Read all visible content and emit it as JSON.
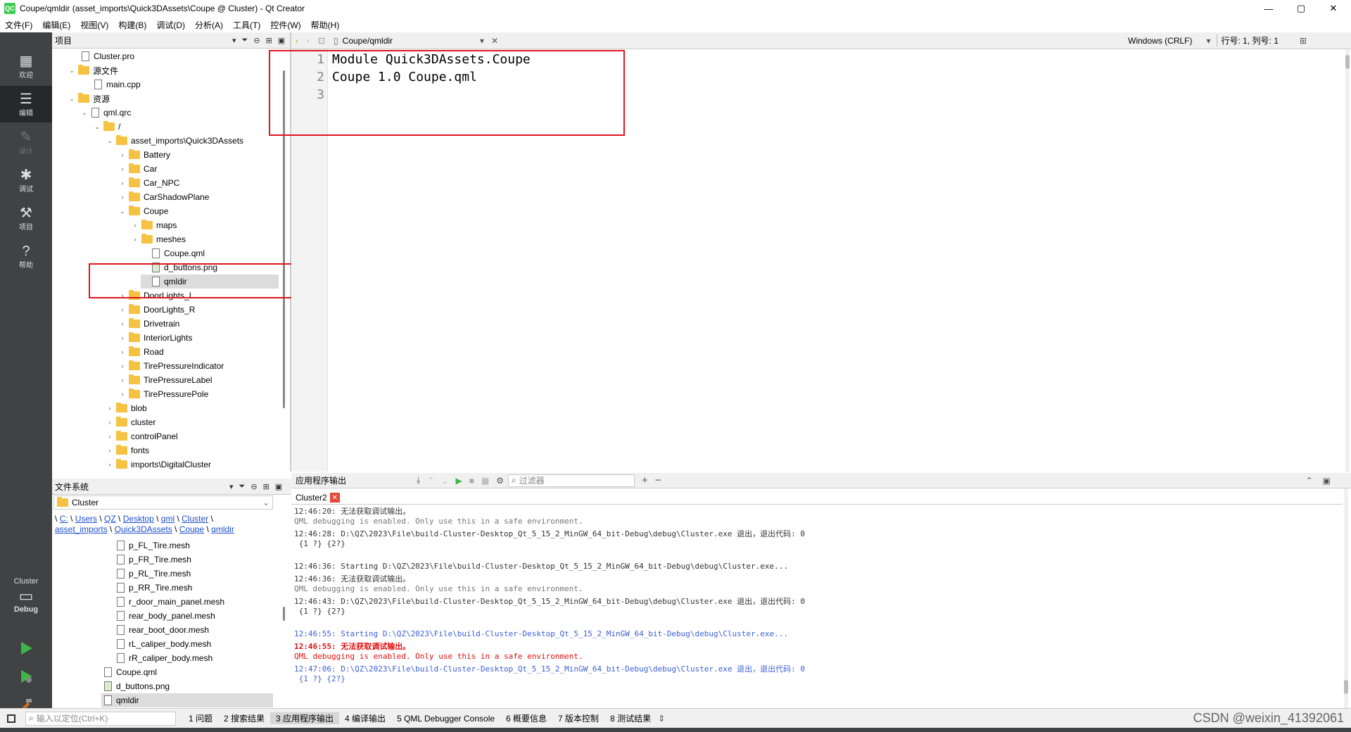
{
  "window": {
    "title": "Coupe/qmldir (asset_imports\\Quick3DAssets\\Coupe @ Cluster) - Qt Creator",
    "app_icon": "QC",
    "minimize": "—",
    "maximize": "▢",
    "close": "✕"
  },
  "menu": [
    "文件(F)",
    "编辑(E)",
    "视图(V)",
    "构建(B)",
    "调试(D)",
    "分析(A)",
    "工具(T)",
    "控件(W)",
    "帮助(H)"
  ],
  "modes": {
    "welcome": "欢迎",
    "edit": "编辑",
    "design": "设计",
    "debug": "调试",
    "projects": "项目",
    "help": "帮助"
  },
  "kit": {
    "name": "Cluster",
    "build": "Debug"
  },
  "projects_pane": {
    "title": "项目",
    "items": [
      {
        "label": "Cluster.pro",
        "kind": "file",
        "depth": 1,
        "arrow": ""
      },
      {
        "label": "源文件",
        "kind": "folder",
        "depth": 0,
        "arrow": "⌄"
      },
      {
        "label": "main.cpp",
        "kind": "file",
        "depth": 2,
        "arrow": ""
      },
      {
        "label": "资源",
        "kind": "folder",
        "depth": 0,
        "arrow": "⌄"
      },
      {
        "label": "qml.qrc",
        "kind": "file",
        "depth": 1,
        "arrow": "⌄"
      },
      {
        "label": "/",
        "kind": "folder",
        "depth": 2,
        "arrow": "⌄"
      },
      {
        "label": "asset_imports\\Quick3DAssets",
        "kind": "folder",
        "depth": 3,
        "arrow": "⌄"
      },
      {
        "label": "Battery",
        "kind": "folder",
        "depth": 4,
        "arrow": "›"
      },
      {
        "label": "Car",
        "kind": "folder",
        "depth": 4,
        "arrow": "›"
      },
      {
        "label": "Car_NPC",
        "kind": "folder",
        "depth": 4,
        "arrow": "›"
      },
      {
        "label": "CarShadowPlane",
        "kind": "folder",
        "depth": 4,
        "arrow": "›"
      },
      {
        "label": "Coupe",
        "kind": "folder",
        "depth": 4,
        "arrow": "⌄"
      },
      {
        "label": "maps",
        "kind": "folder",
        "depth": 5,
        "arrow": "›"
      },
      {
        "label": "meshes",
        "kind": "folder",
        "depth": 5,
        "arrow": "›"
      },
      {
        "label": "Coupe.qml",
        "kind": "file",
        "depth": 6,
        "arrow": ""
      },
      {
        "label": "d_buttons.png",
        "kind": "file",
        "depth": 6,
        "arrow": ""
      },
      {
        "label": "qmldir",
        "kind": "file",
        "depth": 6,
        "arrow": "",
        "selected": true
      },
      {
        "label": "DoorLights_L",
        "kind": "folder",
        "depth": 4,
        "arrow": "›"
      },
      {
        "label": "DoorLights_R",
        "kind": "folder",
        "depth": 4,
        "arrow": "›"
      },
      {
        "label": "Drivetrain",
        "kind": "folder",
        "depth": 4,
        "arrow": "›"
      },
      {
        "label": "InteriorLights",
        "kind": "folder",
        "depth": 4,
        "arrow": "›"
      },
      {
        "label": "Road",
        "kind": "folder",
        "depth": 4,
        "arrow": "›"
      },
      {
        "label": "TirePressureIndicator",
        "kind": "folder",
        "depth": 4,
        "arrow": "›"
      },
      {
        "label": "TirePressureLabel",
        "kind": "folder",
        "depth": 4,
        "arrow": "›"
      },
      {
        "label": "TirePressurePole",
        "kind": "folder",
        "depth": 4,
        "arrow": "›"
      },
      {
        "label": "blob",
        "kind": "folder",
        "depth": 3,
        "arrow": "›"
      },
      {
        "label": "cluster",
        "kind": "folder",
        "depth": 3,
        "arrow": "›"
      },
      {
        "label": "controlPanel",
        "kind": "folder",
        "depth": 3,
        "arrow": "›"
      },
      {
        "label": "fonts",
        "kind": "folder",
        "depth": 3,
        "arrow": "›"
      },
      {
        "label": "imports\\DigitalCluster",
        "kind": "folder",
        "depth": 3,
        "arrow": "›"
      }
    ]
  },
  "filesystem_pane": {
    "title": "文件系统",
    "root": "Cluster",
    "breadcrumb_line1": [
      "C:",
      "Users",
      "QZ",
      "Desktop",
      "qml",
      "Cluster"
    ],
    "breadcrumb_line2": [
      "asset_imports",
      "Quick3DAssets",
      "Coupe",
      "qmldir"
    ],
    "items": [
      {
        "label": "p_FL_Tire.mesh",
        "depth": 1
      },
      {
        "label": "p_FR_Tire.mesh",
        "depth": 1
      },
      {
        "label": "p_RL_Tire.mesh",
        "depth": 1
      },
      {
        "label": "p_RR_Tire.mesh",
        "depth": 1
      },
      {
        "label": "r_door_main_panel.mesh",
        "depth": 1
      },
      {
        "label": "rear_body_panel.mesh",
        "depth": 1
      },
      {
        "label": "rear_boot_door.mesh",
        "depth": 1
      },
      {
        "label": "rL_caliper_body.mesh",
        "depth": 1
      },
      {
        "label": "rR_caliper_body.mesh",
        "depth": 1
      },
      {
        "label": "Coupe.qml",
        "depth": 0
      },
      {
        "label": "d_buttons.png",
        "depth": 0
      },
      {
        "label": "qmldir",
        "depth": 0,
        "selected": true
      }
    ]
  },
  "editor": {
    "file_label": "Coupe/qmldir",
    "line_ending": "Windows (CRLF)",
    "position": "行号: 1, 列号: 1",
    "lines": [
      "Module Quick3DAssets.Coupe",
      "Coupe 1.0 Coupe.qml",
      ""
    ]
  },
  "output_pane": {
    "title": "应用程序输出",
    "filter_placeholder": "过滤器",
    "tab": "Cluster2",
    "lines": [
      {
        "text": "12:46:20: 无法获取调试输出。",
        "color": "#333333"
      },
      {
        "text": "QML debugging is enabled. Only use this in a safe environment.",
        "color": "#777777"
      },
      {
        "text": "12:46:28: D:\\QZ\\2023\\File\\build-Cluster-Desktop_Qt_5_15_2_MinGW_64_bit-Debug\\debug\\Cluster.exe 退出，退出代码: 0",
        "color": "#333333"
      },
      {
        "text": " {1 ?} {2?}",
        "color": "#333333"
      },
      {
        "text": "",
        "color": "#333333"
      },
      {
        "text": "12:46:36: Starting D:\\QZ\\2023\\File\\build-Cluster-Desktop_Qt_5_15_2_MinGW_64_bit-Debug\\debug\\Cluster.exe...",
        "color": "#333333"
      },
      {
        "text": "12:46:36: 无法获取调试输出。",
        "color": "#333333"
      },
      {
        "text": "QML debugging is enabled. Only use this in a safe environment.",
        "color": "#777777"
      },
      {
        "text": "12:46:43: D:\\QZ\\2023\\File\\build-Cluster-Desktop_Qt_5_15_2_MinGW_64_bit-Debug\\debug\\Cluster.exe 退出，退出代码: 0",
        "color": "#333333"
      },
      {
        "text": " {1 ?} {2?}",
        "color": "#333333"
      },
      {
        "text": "",
        "color": "#333333"
      },
      {
        "text": "12:46:55: Starting D:\\QZ\\2023\\File\\build-Cluster-Desktop_Qt_5_15_2_MinGW_64_bit-Debug\\debug\\Cluster.exe...",
        "color": "#3c5fd6"
      },
      {
        "text": "12:46:55: 无法获取调试输出。",
        "color": "#e01010"
      },
      {
        "text": "QML debugging is enabled. Only use this in a safe environment.",
        "color": "#e01010"
      },
      {
        "text": "12:47:06: D:\\QZ\\2023\\File\\build-Cluster-Desktop_Qt_5_15_2_MinGW_64_bit-Debug\\debug\\Cluster.exe 退出，退出代码: 0",
        "color": "#3c5fd6"
      },
      {
        "text": " {1 ?} {2?}",
        "color": "#3c5fd6"
      }
    ]
  },
  "statusbar": {
    "locator_placeholder": "输入以定位(Ctrl+K)",
    "tabs": [
      "1 问题",
      "2 搜索结果",
      "3 应用程序输出",
      "4 编译输出",
      "5 QML Debugger Console",
      "6 概要信息",
      "7 版本控制",
      "8 测试结果"
    ],
    "active_tab": 2,
    "watermark": "CSDN @weixin_41392061"
  },
  "colors": {
    "accent_red": "#e0151f",
    "sidebar_bg": "#404244",
    "run_green": "#3fb54a"
  }
}
